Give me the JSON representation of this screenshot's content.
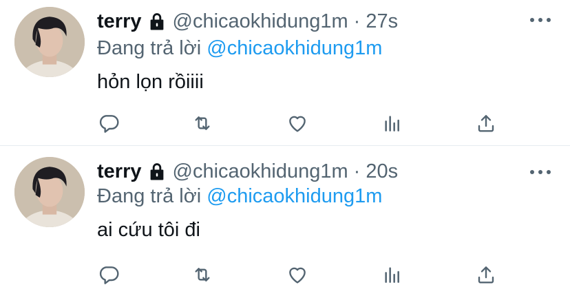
{
  "tweets": [
    {
      "name": "terry",
      "handle": "@chicaokhidung1m",
      "dot": "·",
      "time": "27s",
      "reply_prefix": "Đang trả lời",
      "reply_mention": "@chicaokhidung1m",
      "text": "hỏn lọn rồiiii",
      "icons": {
        "lock": "lock-icon",
        "more": "more-horizontal-icon",
        "reply": "reply-icon",
        "retweet": "retweet-icon",
        "like": "heart-icon",
        "stats": "analytics-icon",
        "share": "share-icon"
      }
    },
    {
      "name": "terry",
      "handle": "@chicaokhidung1m",
      "dot": "·",
      "time": "20s",
      "reply_prefix": "Đang trả lời",
      "reply_mention": "@chicaokhidung1m",
      "text": "ai cứu tôi đi",
      "icons": {
        "lock": "lock-icon",
        "more": "more-horizontal-icon",
        "reply": "reply-icon",
        "retweet": "retweet-icon",
        "like": "heart-icon",
        "stats": "analytics-icon",
        "share": "share-icon"
      }
    }
  ],
  "colors": {
    "text": "#0f1419",
    "secondary": "#536471",
    "link": "#1d9bf0",
    "divider": "#e6ecf0"
  }
}
